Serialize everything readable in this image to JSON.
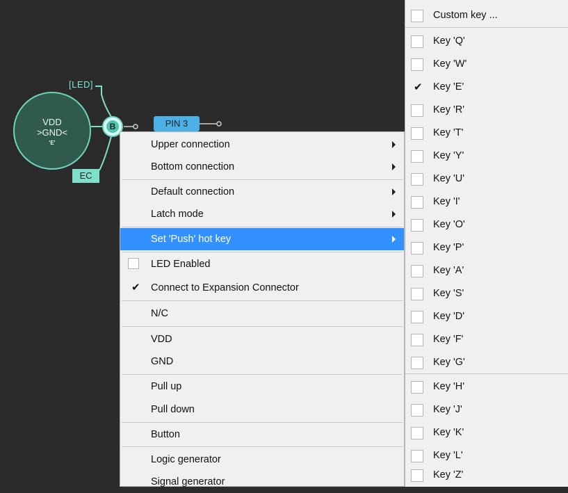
{
  "canvas": {
    "main_circle": {
      "line1": "VDD",
      "line2": ">GND<",
      "line3": "'E'"
    },
    "node_label": "B",
    "led_label": "[LED]",
    "ec_label": "EC",
    "pin_label": "PIN 3"
  },
  "context_menu": {
    "items": [
      {
        "label": "Upper connection",
        "submenu": true
      },
      {
        "label": "Bottom connection",
        "submenu": true
      },
      {
        "label": "Default connection",
        "submenu": true
      },
      {
        "label": "Latch mode",
        "submenu": true
      },
      {
        "label": "Set 'Push' hot key",
        "submenu": true,
        "selected": true
      },
      {
        "label": "LED Enabled",
        "checkbox": true,
        "checked": false
      },
      {
        "label": "Connect to Expansion Connector",
        "checkbox": false,
        "checked": true
      },
      {
        "label": "N/C"
      },
      {
        "label": "VDD"
      },
      {
        "label": "GND"
      },
      {
        "label": "Pull up"
      },
      {
        "label": "Pull down"
      },
      {
        "label": "Button"
      },
      {
        "label": "Logic generator"
      },
      {
        "label": "Signal generator"
      }
    ]
  },
  "hotkey_menu": {
    "items": [
      {
        "label": "Custom key ...",
        "checked": false
      },
      {
        "label": "Key 'Q'",
        "checked": false
      },
      {
        "label": "Key 'W'",
        "checked": false
      },
      {
        "label": "Key 'E'",
        "checked": true
      },
      {
        "label": "Key 'R'",
        "checked": false
      },
      {
        "label": "Key 'T'",
        "checked": false
      },
      {
        "label": "Key 'Y'",
        "checked": false
      },
      {
        "label": "Key 'U'",
        "checked": false
      },
      {
        "label": "Key 'I'",
        "checked": false
      },
      {
        "label": "Key 'O'",
        "checked": false
      },
      {
        "label": "Key 'P'",
        "checked": false
      },
      {
        "label": "Key 'A'",
        "checked": false
      },
      {
        "label": "Key 'S'",
        "checked": false
      },
      {
        "label": "Key 'D'",
        "checked": false
      },
      {
        "label": "Key 'F'",
        "checked": false
      },
      {
        "label": "Key 'G'",
        "checked": false
      },
      {
        "label": "Key 'H'",
        "checked": false
      },
      {
        "label": "Key 'J'",
        "checked": false
      },
      {
        "label": "Key 'K'",
        "checked": false
      },
      {
        "label": "Key 'L'",
        "checked": false
      },
      {
        "label": "Key 'Z'",
        "checked": false
      }
    ]
  },
  "colors": {
    "background": "#2b2b2b",
    "component_stroke": "#6fd4bd",
    "pin_fill": "#4ab0e6",
    "menu_bg": "#f0f0f0",
    "menu_highlight": "#3390ff"
  }
}
